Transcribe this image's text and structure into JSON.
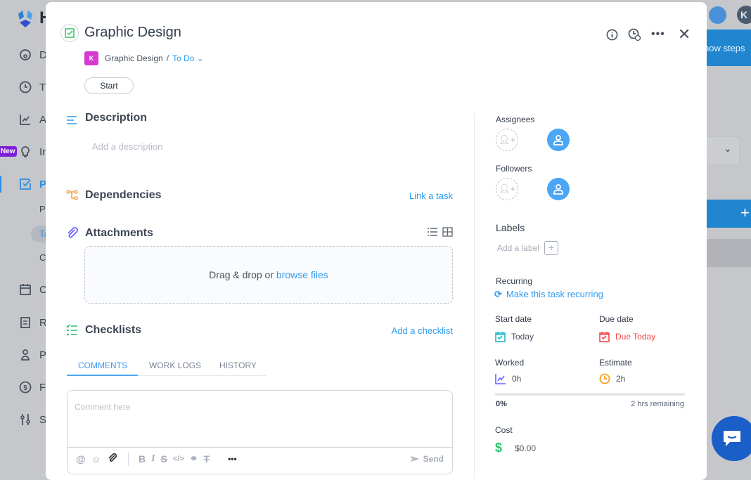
{
  "app": {
    "logo_letter": "H",
    "topbar_avatar_letter": "K",
    "banner_text": "now steps"
  },
  "sidebar": {
    "new_badge": "New",
    "items": [
      {
        "label": "Da",
        "icon": "dashboard-icon"
      },
      {
        "label": "Ti",
        "icon": "clock-icon"
      },
      {
        "label": "Ac",
        "icon": "activity-icon"
      },
      {
        "label": "In",
        "icon": "lightbulb-icon"
      },
      {
        "label": "Pr",
        "icon": "checkbox-icon"
      },
      {
        "label": "Ca",
        "icon": "calendar-icon"
      },
      {
        "label": "Re",
        "icon": "report-icon"
      },
      {
        "label": "Pe",
        "icon": "person-icon"
      },
      {
        "label": "Fi",
        "icon": "dollar-icon"
      },
      {
        "label": "Se",
        "icon": "settings-icon"
      }
    ],
    "subitems": [
      "Pr",
      "Ta",
      "Cl"
    ]
  },
  "task": {
    "title": "Graphic Design",
    "project_badge": "K",
    "project": "Graphic Design",
    "separator": "/",
    "status": "To Do",
    "start_label": "Start"
  },
  "sections": {
    "description": {
      "title": "Description",
      "placeholder": "Add a description"
    },
    "dependencies": {
      "title": "Dependencies",
      "action": "Link a task"
    },
    "attachments": {
      "title": "Attachments",
      "drop_text": "Drag & drop or ",
      "browse": "browse files"
    },
    "checklists": {
      "title": "Checklists",
      "action": "Add a checklist"
    }
  },
  "tabs": [
    {
      "label": "COMMENTS",
      "active": true
    },
    {
      "label": "WORK LOGS"
    },
    {
      "label": "HISTORY"
    }
  ],
  "comment": {
    "placeholder": "Comment here",
    "send": "Send"
  },
  "details": {
    "assignees": "Assignees",
    "followers": "Followers",
    "labels": "Labels",
    "add_label": "Add a label",
    "recurring": "Recurring",
    "make_recurring": "Make this task recurring",
    "start_date_label": "Start date",
    "start_date": "Today",
    "due_date_label": "Due date",
    "due_date": "Due Today",
    "worked_label": "Worked",
    "worked": "0h",
    "estimate_label": "Estimate",
    "estimate": "2h",
    "progress_percent": "0%",
    "progress_value": 0,
    "remaining": "2 hrs remaining",
    "cost_label": "Cost",
    "cost": "$0.00"
  },
  "colors": {
    "accent": "#2e9cf0",
    "project_badge": "#d63ad0",
    "due": "#f04848",
    "green": "#2bc26a",
    "purple": "#6c63ff",
    "orange": "#f4a020"
  }
}
